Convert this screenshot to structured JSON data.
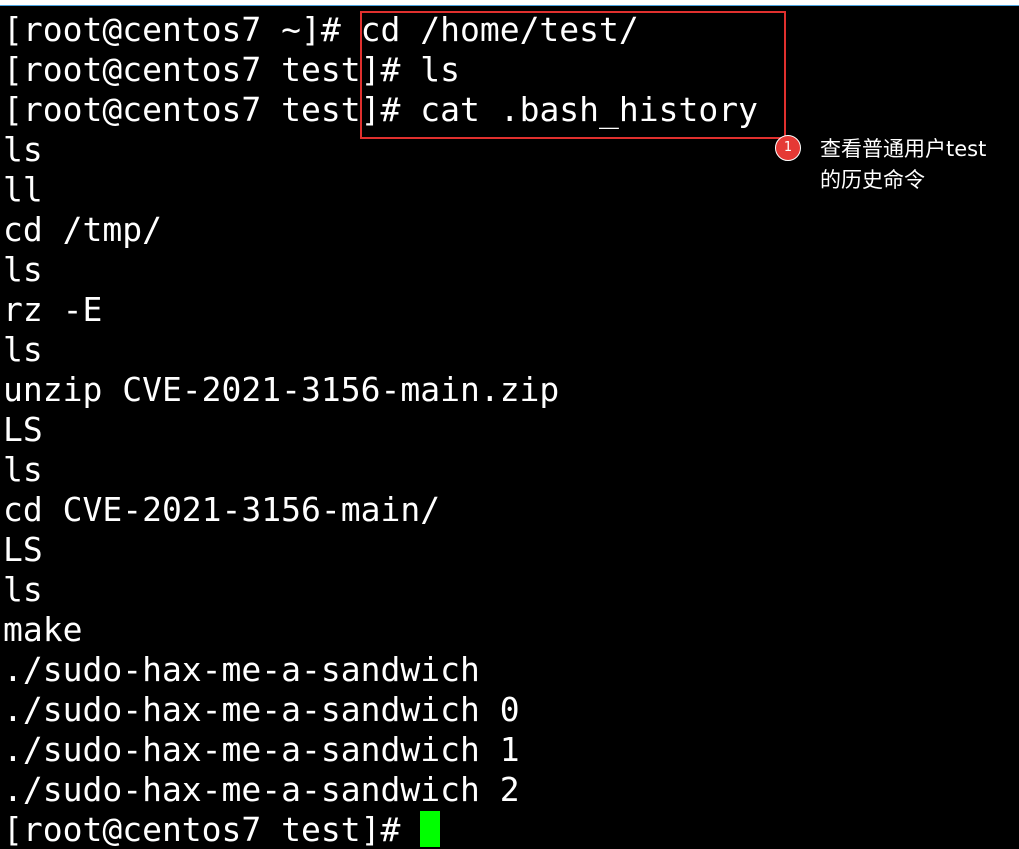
{
  "terminal": {
    "lines": [
      {
        "prompt": "[root@centos7 ~]# ",
        "command": "cd /home/test/"
      },
      {
        "prompt": "[root@centos7 test]# ",
        "command": "ls"
      },
      {
        "prompt": "[root@centos7 test]# ",
        "command": "cat .bash_history"
      },
      {
        "text": "ls"
      },
      {
        "text": "ll"
      },
      {
        "text": "cd /tmp/"
      },
      {
        "text": "ls"
      },
      {
        "text": "rz -E"
      },
      {
        "text": "ls"
      },
      {
        "text": "unzip CVE-2021-3156-main.zip"
      },
      {
        "text": "LS"
      },
      {
        "text": "ls"
      },
      {
        "text": "cd CVE-2021-3156-main/"
      },
      {
        "text": "LS"
      },
      {
        "text": "ls"
      },
      {
        "text": "make"
      },
      {
        "text": "./sudo-hax-me-a-sandwich"
      },
      {
        "text": "./sudo-hax-me-a-sandwich 0"
      },
      {
        "text": "./sudo-hax-me-a-sandwich 1"
      },
      {
        "text": "./sudo-hax-me-a-sandwich 2"
      }
    ],
    "current_prompt": "[root@centos7 test]# "
  },
  "annotation": {
    "badge_number": "1",
    "text_line1": "查看普通用户test",
    "text_line2": "的历史命令",
    "color": "#e53935"
  },
  "colors": {
    "background": "#000000",
    "foreground": "#ffffff",
    "cursor": "#00ff00",
    "highlight_border": "#e0302e"
  }
}
